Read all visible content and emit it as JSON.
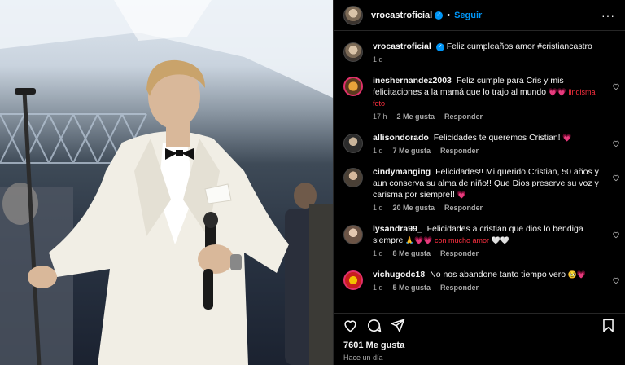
{
  "header": {
    "username": "vrocastroficial",
    "follow_label": "Seguir",
    "separator": "•",
    "more_label": "···"
  },
  "caption": {
    "username": "vrocastroficial",
    "text": "Feliz cumpleaños amor #cristiancastro",
    "time": "1 d"
  },
  "comments": [
    {
      "username": "ineshernandez2003",
      "text": "Feliz cumple para Cris y mis felicitaciones a la mamá que lo trajo al mundo",
      "emoji_tail": " 💗💗 lindisma foto",
      "time": "17 h",
      "likes": "2 Me gusta",
      "reply": "Responder"
    },
    {
      "username": "allisondorado",
      "text": "Felicidades te queremos Cristian!",
      "emoji_tail": " 💗",
      "time": "1 d",
      "likes": "7 Me gusta",
      "reply": "Responder"
    },
    {
      "username": "cindymanging",
      "text": "Felicidades!! Mi querido Cristian, 50 años y aun conserva su alma de niño!! Que Dios preserve su voz y carisma por siempre!!",
      "emoji_tail": " 💗",
      "time": "1 d",
      "likes": "20 Me gusta",
      "reply": "Responder"
    },
    {
      "username": "lysandra99_",
      "text": "Felicidades a cristian que dios lo bendiga siempre",
      "emoji_tail": " 🙏💗💗 con mucho amor 🤍🤍",
      "time": "1 d",
      "likes": "8 Me gusta",
      "reply": "Responder"
    },
    {
      "username": "vichugodc18",
      "text": "No nos abandone tanto tiempo vero",
      "emoji_tail": " 🥹💗",
      "time": "1 d",
      "likes": "5 Me gusta",
      "reply": "Responder"
    }
  ],
  "footer": {
    "likes": "7601 Me gusta",
    "time_ago": "Hace un día"
  },
  "colors": {
    "background": "#000000",
    "text": "#f5f5f5",
    "muted": "#a8a8a8",
    "accent": "#0095f6",
    "heart": "#ff3040"
  }
}
